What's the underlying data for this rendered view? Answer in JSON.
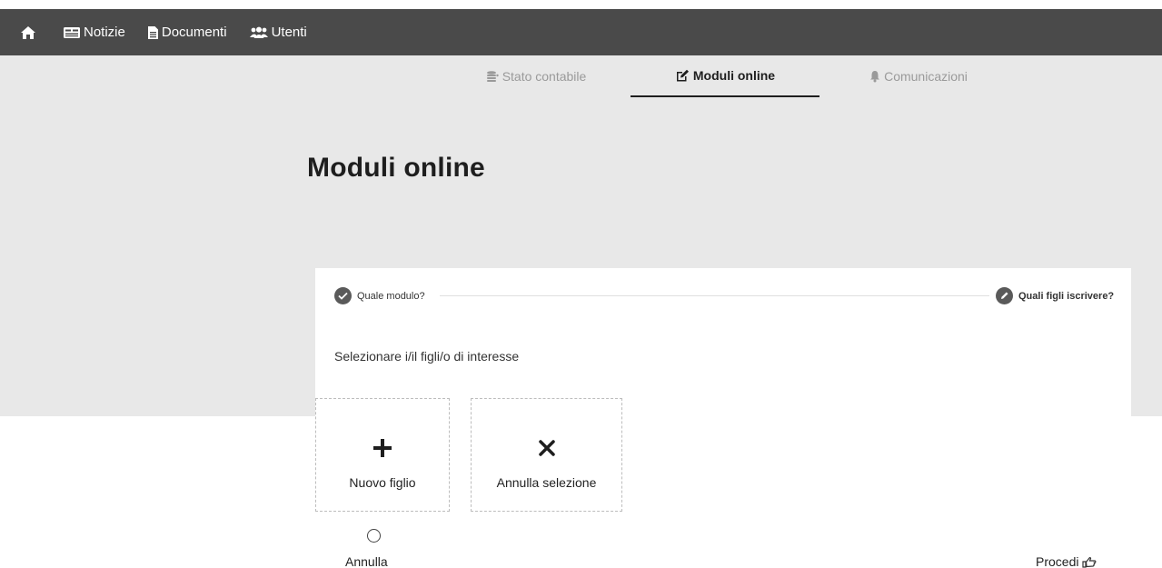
{
  "navbar": {
    "items": [
      {
        "label": "Notizie",
        "icon": "newspaper-icon"
      },
      {
        "label": "Documenti",
        "icon": "document-icon"
      },
      {
        "label": "Utenti",
        "icon": "users-icon"
      }
    ]
  },
  "tabs": [
    {
      "label": "Stato contabile",
      "icon": "coins-icon",
      "active": false
    },
    {
      "label": "Moduli online",
      "icon": "edit-icon",
      "active": true
    },
    {
      "label": "Comunicazioni",
      "icon": "bell-icon",
      "active": false
    }
  ],
  "page": {
    "title": "Moduli online"
  },
  "wizard": {
    "steps": [
      {
        "label": "Quale modulo?",
        "state": "done"
      },
      {
        "label": "Quali figli iscrivere?",
        "state": "current"
      }
    ],
    "instruction": "Selezionare i/il figli/o di interesse",
    "options": [
      {
        "label": "Nuovo figlio",
        "icon": "plus-icon"
      },
      {
        "label": "Annulla selezione",
        "icon": "times-icon"
      }
    ],
    "cancel_label": "Annulla",
    "proceed_label": "Procedi"
  },
  "colors": {
    "navbar": "#4a4a4a",
    "band": "#e8e8e8",
    "active_tab": "#1e1e1e",
    "inactive_tab": "#9a9a9a",
    "step_circle": "#5a5a5a"
  }
}
